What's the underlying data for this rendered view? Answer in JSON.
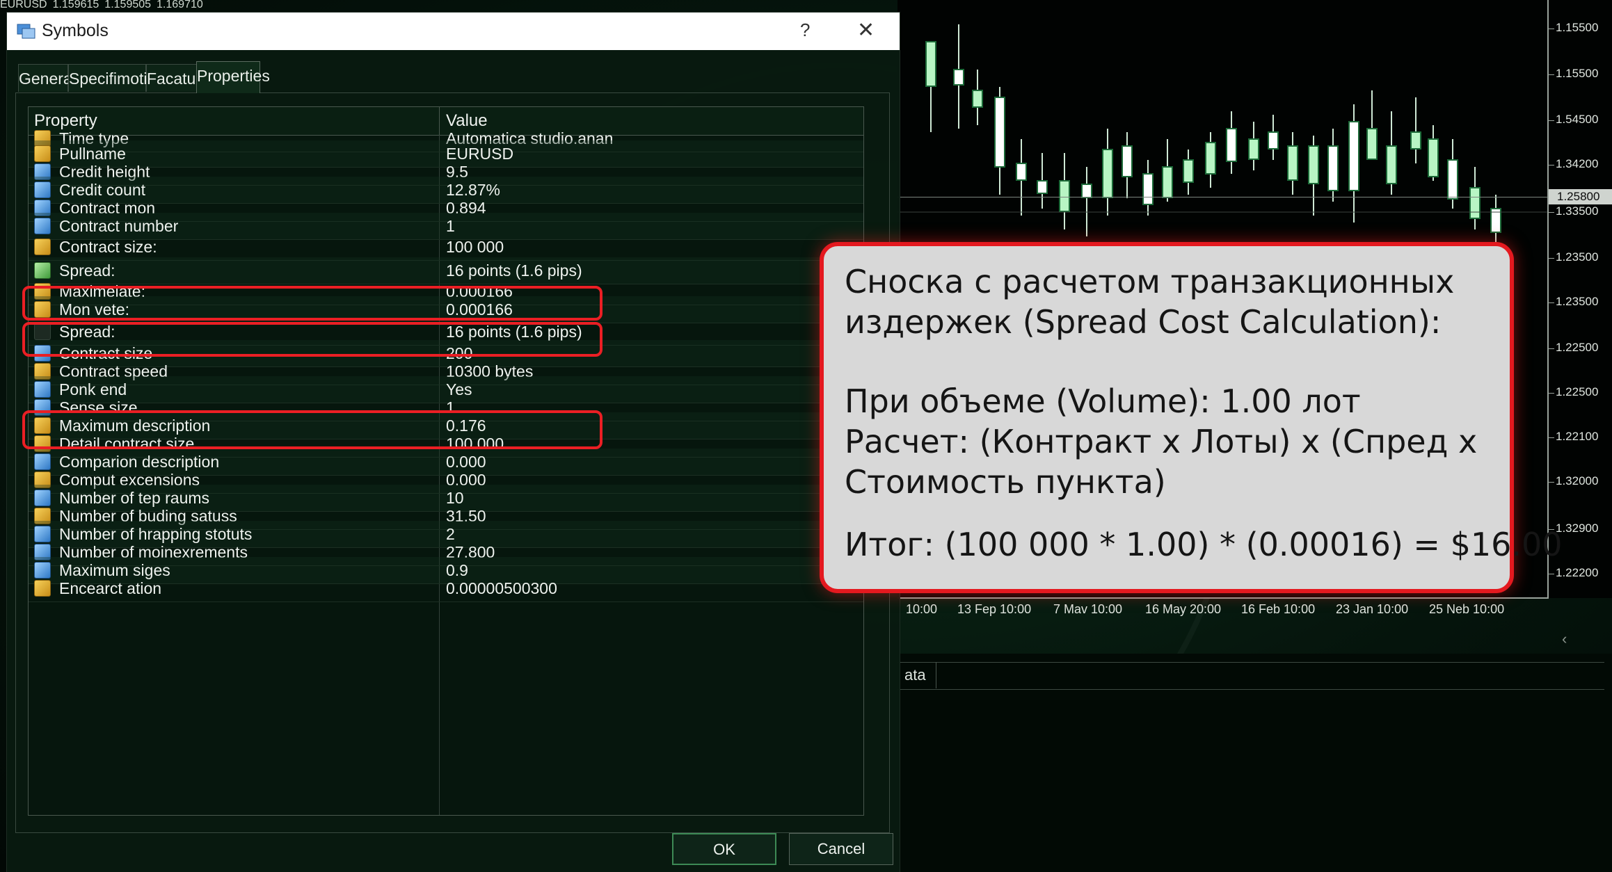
{
  "chart": {
    "symbol_line": [
      "EURUSD",
      "1.159615",
      "1.159505",
      "1.169710"
    ],
    "price_labels": [
      "1.15500",
      "1.15500",
      "1.54500",
      "1.34200",
      "1.33500",
      "1.23500",
      "1.23500",
      "1.22500",
      "1.22500",
      "1.22100",
      "1.32000",
      "1.32900",
      "1.22200"
    ],
    "current_price": "1.25800",
    "date_labels": [
      "10:00",
      "13 Fep 10:00",
      "7 Mav 10:00",
      "16 May 20:00",
      "16 Feb 10:00",
      "23 Jan 10:00",
      "25 Neb 10:00"
    ],
    "nav_arrows": "‹ ›",
    "lower_tab": "ata",
    "bull_color": "#b8f5c4",
    "bear_color": "#ffffff"
  },
  "dialog": {
    "title": "Symbols",
    "help": "?",
    "close": "✕",
    "tabs": [
      "General",
      "Specifimotics",
      "Facatuss",
      "Properties"
    ],
    "active_tab": "Properties",
    "columns": {
      "property": "Property",
      "value": "Value"
    },
    "rows": [
      {
        "property": "Time type",
        "value": "Automatica studio.anan",
        "icon": "ico-yellow"
      },
      {
        "property": "Pullname",
        "value": "EURUSD",
        "icon": "ico-yellow"
      },
      {
        "property": "Credit height",
        "value": "9.5",
        "icon": "ico-blue"
      },
      {
        "property": "Credit count",
        "value": "12.87%",
        "icon": "ico-blue"
      },
      {
        "property": "Contract mon",
        "value": "0.894",
        "icon": "ico-blue"
      },
      {
        "property": "Contract number",
        "value": "1",
        "icon": "ico-blue"
      },
      {
        "property": "Contract size:",
        "value": "100 000",
        "icon": "ico-yellow"
      },
      {
        "property": "Spread:",
        "value": "16 points (1.6 pips)",
        "icon": "ico-green"
      },
      {
        "property": "Maximelate:",
        "value": "0.000166",
        "icon": "ico-yellow"
      },
      {
        "property": "Mon vete:",
        "value": "0.000166",
        "icon": "ico-yellow"
      },
      {
        "property": "Spread:",
        "value": "16 points (1.6 pips)",
        "icon": "ico-dark"
      },
      {
        "property": "Contract size",
        "value": "200",
        "icon": "ico-blue"
      },
      {
        "property": "Contract speed",
        "value": "10300 bytes",
        "icon": "ico-yellow"
      },
      {
        "property": "Ponk end",
        "value": "Yes",
        "icon": "ico-blue"
      },
      {
        "property": "Sense size",
        "value": "1",
        "icon": "ico-blue"
      },
      {
        "property": "Maximum description",
        "value": "0.176",
        "icon": "ico-yellow"
      },
      {
        "property": "Detail contract size",
        "value": "100 000",
        "icon": "ico-yellow"
      },
      {
        "property": "Comparion description",
        "value": "0.000",
        "icon": "ico-blue"
      },
      {
        "property": "Comput excensions",
        "value": "0.000",
        "icon": "ico-yellow"
      },
      {
        "property": "Number of tep raums",
        "value": "10",
        "icon": "ico-blue"
      },
      {
        "property": "Number of buding satuss",
        "value": "31.50",
        "icon": "ico-yellow"
      },
      {
        "property": "Number of hrapping stotuts",
        "value": "2",
        "icon": "ico-blue"
      },
      {
        "property": "Number of moinexrements",
        "value": "27.800",
        "icon": "ico-blue"
      },
      {
        "property": "Maximum siges",
        "value": "0.9",
        "icon": "ico-blue"
      },
      {
        "property": "Encearct ation",
        "value": "0.00000500300",
        "icon": "ico-yellow"
      }
    ],
    "highlighted_rows": [
      6,
      7,
      10
    ],
    "ok_label": "OK",
    "cancel_label": "Cancel"
  },
  "callout": {
    "line1": "Сноска с расчетом транзакционных",
    "line2": "издержек (Spread Cost Calculation):",
    "line3": "При объеме (Volume): 1.00 лот",
    "line4": "Расчет: (Контракт x Лоты) x (Спред x",
    "line5": "Стоимость пункта)",
    "line6": "Итог: (100 000 * 1.00) * (0.00016) = $16.00",
    "border_color": "#e4191f"
  }
}
